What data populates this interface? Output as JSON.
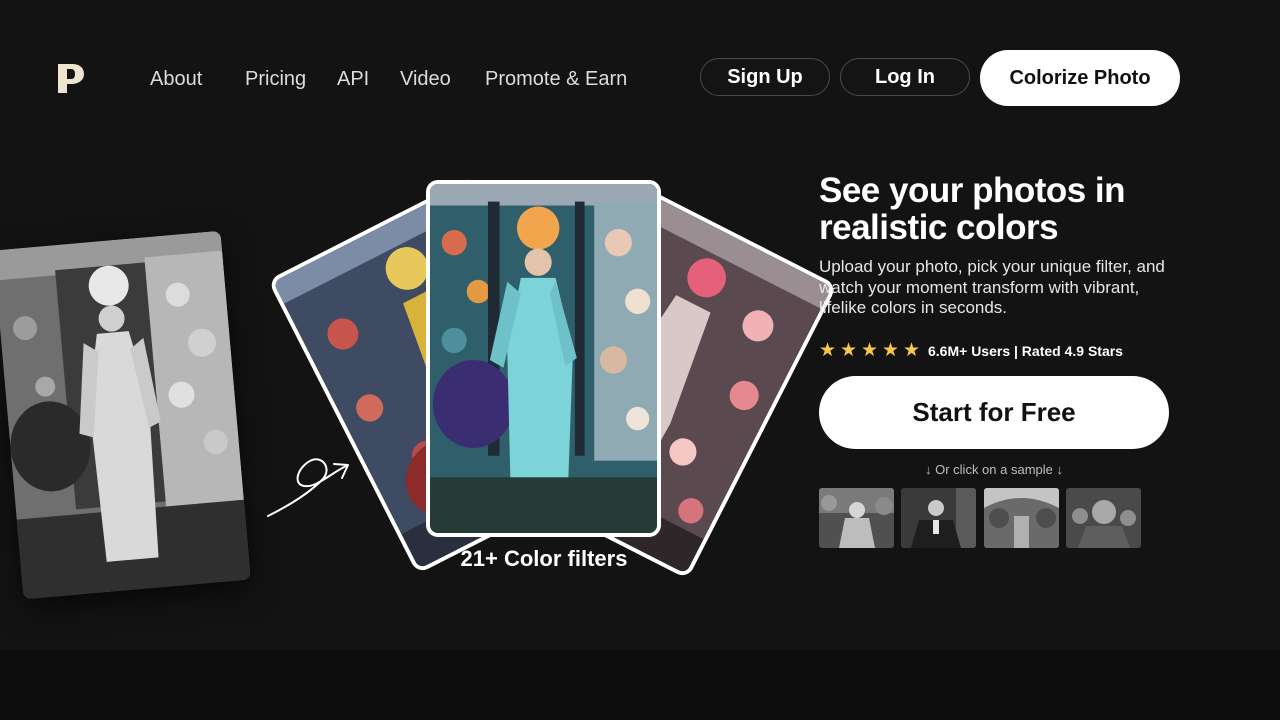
{
  "nav": {
    "logo": "P",
    "links": [
      "About",
      "Pricing",
      "API",
      "Video",
      "Promote & Earn"
    ],
    "sign_up": "Sign Up",
    "log_in": "Log In",
    "colorize": "Colorize Photo"
  },
  "showcase": {
    "filters_label": "21+ Color filters"
  },
  "hero": {
    "title": "See your photos in realistic colors",
    "subtitle": "Upload your photo, pick your unique filter, and watch your moment transform with vibrant, lifelike colors in seconds.",
    "rating_text": "6.6M+ Users | Rated 4.9 Stars",
    "stars": 5,
    "cta": "Start for Free",
    "sample_hint": "↓ Or click on a sample ↓"
  },
  "colors": {
    "background": "#141314",
    "star": "#f5c74a",
    "button_bg": "#ffffff"
  }
}
